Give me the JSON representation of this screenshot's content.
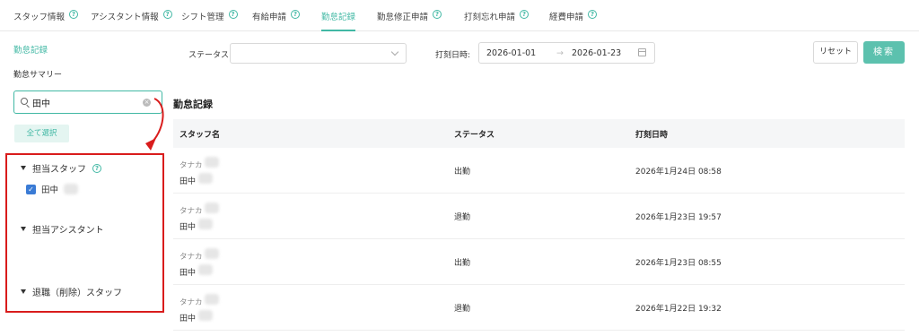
{
  "tabs": [
    {
      "label": "スタッフ情報",
      "help": "?",
      "active": false
    },
    {
      "label": "アシスタント情報",
      "help": "?",
      "active": false
    },
    {
      "label": "シフト管理",
      "help": "?",
      "active": false
    },
    {
      "label": "有給申請",
      "help": "?",
      "active": false
    },
    {
      "label": "勤怠記録",
      "help": "",
      "active": true
    },
    {
      "label": "勤怠修正申請",
      "help": "?",
      "active": false
    },
    {
      "label": "打刻忘れ申請",
      "help": "?",
      "active": false
    },
    {
      "label": "経費申請",
      "help": "?",
      "active": false
    }
  ],
  "sidebar": {
    "link": "勤怠記録",
    "summary": "勤怠サマリー",
    "search_value": "田中",
    "clear": "×",
    "select_all": "全て選択",
    "groups": [
      {
        "label": "担当スタッフ",
        "help": "?"
      },
      {
        "label": "担当アシスタント"
      },
      {
        "label": "退職（削除）スタッフ"
      }
    ],
    "staff_item": {
      "name": "田中",
      "checked": true,
      "check": "✓"
    }
  },
  "filters": {
    "status_label": "ステータス:",
    "date_label": "打刻日時:",
    "date_from": "2026-01-01",
    "date_sep": "→",
    "date_to": "2026-01-23",
    "reset": "リセット",
    "search": "検索"
  },
  "table": {
    "title": "勤怠記録",
    "headers": [
      "スタッフ名",
      "ステータス",
      "打刻日時"
    ],
    "rows": [
      {
        "kana": "タナカ",
        "name": "田中",
        "status": "出勤",
        "time": "2026年1月24日 08:58"
      },
      {
        "kana": "タナカ",
        "name": "田中",
        "status": "退勤",
        "time": "2026年1月23日 19:57"
      },
      {
        "kana": "タナカ",
        "name": "田中",
        "status": "出勤",
        "time": "2026年1月23日 08:55"
      },
      {
        "kana": "タナカ",
        "name": "田中",
        "status": "退勤",
        "time": "2026年1月22日 19:32"
      }
    ]
  },
  "colors": {
    "accent": "#41b8a4",
    "highlight": "#d91c1c",
    "checkbox": "#3a7bd5"
  }
}
